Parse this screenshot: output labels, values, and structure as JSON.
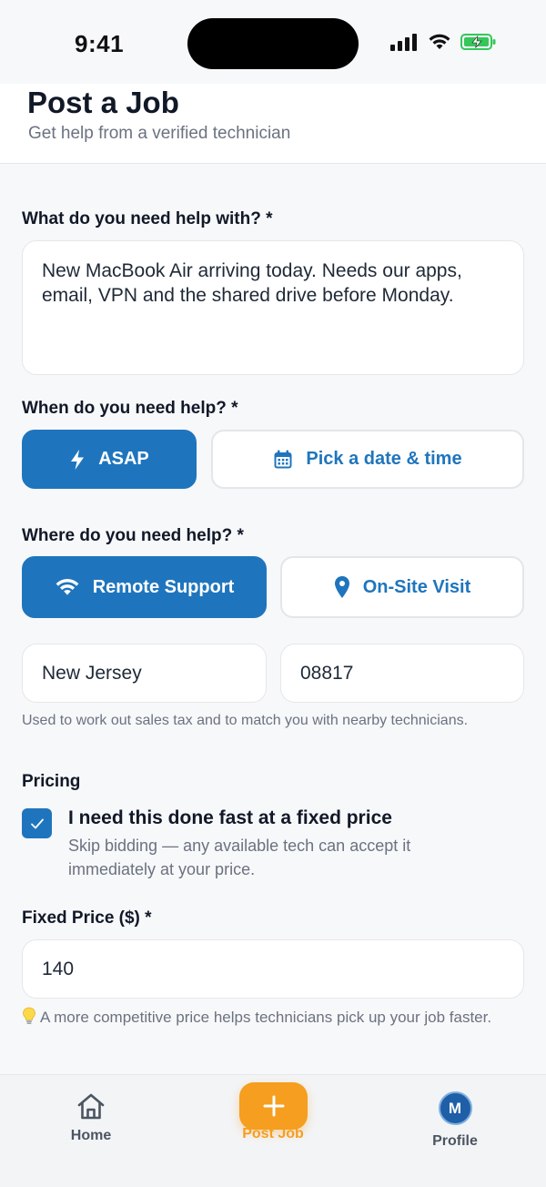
{
  "status_bar": {
    "time": "9:41"
  },
  "header": {
    "title": "Post a Job",
    "subtitle": "Get help from a verified technician"
  },
  "form": {
    "description": {
      "label": "What do you need help with? *",
      "value": "New MacBook Air arriving today. Needs our apps, email, VPN and the shared drive before Monday."
    },
    "when": {
      "label": "When do you need help? *",
      "asap": "ASAP",
      "pick": "Pick a date & time",
      "selected": "ASAP"
    },
    "where": {
      "label": "Where do you need help? *",
      "remote": "Remote Support",
      "onsite": "On-Site Visit",
      "selected": "Remote Support"
    },
    "state": "New Jersey",
    "zip": "08817",
    "location_helper": "Used to work out sales tax and to match you with nearby technicians.",
    "pricing": {
      "label": "Pricing",
      "checkbox_title": "I need this done fast at a fixed price",
      "checkbox_desc": "Skip bidding — any available tech can accept it immediately at your price.",
      "checked": true
    },
    "fixed_price": {
      "label": "Fixed Price ($) *",
      "value": "140"
    },
    "tip": "A more competitive price helps technicians pick up your job faster."
  },
  "tabbar": {
    "home": "Home",
    "post": "Post Job",
    "profile": "Profile",
    "avatar_initial": "M"
  },
  "colors": {
    "primary": "#1f75bd",
    "accent": "#f59e1f",
    "battery": "#34c759"
  },
  "icons": [
    "signal-icon",
    "wifi-icon",
    "battery-icon",
    "bolt-icon",
    "calendar-icon",
    "wifi-icon",
    "location-pin-icon",
    "checkmark-icon",
    "lightbulb-icon",
    "home-icon",
    "plus-icon"
  ]
}
